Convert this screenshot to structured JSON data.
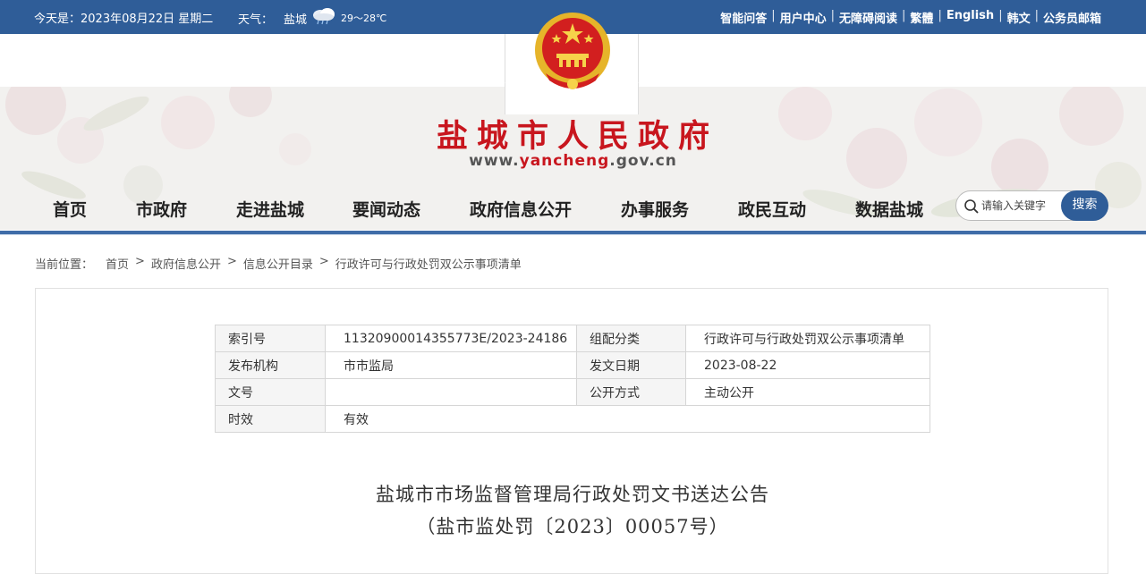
{
  "topbar": {
    "date": "今天是：2023年08月22日 星期二",
    "weather_label": "天气：",
    "weather_city": "盐城",
    "weather_temp": "29～28℃",
    "links": [
      "智能问答",
      "用户中心",
      "无障碍阅读",
      "繁體",
      "English",
      "韩文",
      "公务员邮箱"
    ]
  },
  "site": {
    "title": "盐城市人民政府",
    "url_prefix": "www.",
    "url_accent": "yancheng",
    "url_suffix": ".gov.cn"
  },
  "nav": {
    "items": [
      "首页",
      "市政府",
      "走进盐城",
      "要闻动态",
      "政府信息公开",
      "办事服务",
      "政民互动",
      "数据盐城"
    ]
  },
  "search": {
    "placeholder": "请输入关键字",
    "button": "搜索"
  },
  "breadcrumb": {
    "lead": "当前位置：",
    "items": [
      "首页",
      "政府信息公开",
      "信息公开目录",
      "行政许可与行政处罚双公示事项清单"
    ],
    "separator": ">"
  },
  "meta": {
    "rows": [
      {
        "k1": "索引号",
        "v1": "11320900014355773E/2023-24186",
        "k2": "组配分类",
        "v2": "行政许可与行政处罚双公示事项清单"
      },
      {
        "k1": "发布机构",
        "v1": "市市监局",
        "k2": "发文日期",
        "v2": "2023-08-22"
      },
      {
        "k1": "文号",
        "v1": "",
        "k2": "公开方式",
        "v2": "主动公开"
      },
      {
        "k1": "时效",
        "v1": "有效"
      }
    ]
  },
  "document": {
    "title": "盐城市市场监督管理局行政处罚文书送达公告",
    "subtitle": "（盐市监处罚〔2023〕00057号）"
  },
  "colors": {
    "topbar": "#2f5d98",
    "title_red": "#c8161e",
    "nav_line": "#3f6ca8"
  }
}
